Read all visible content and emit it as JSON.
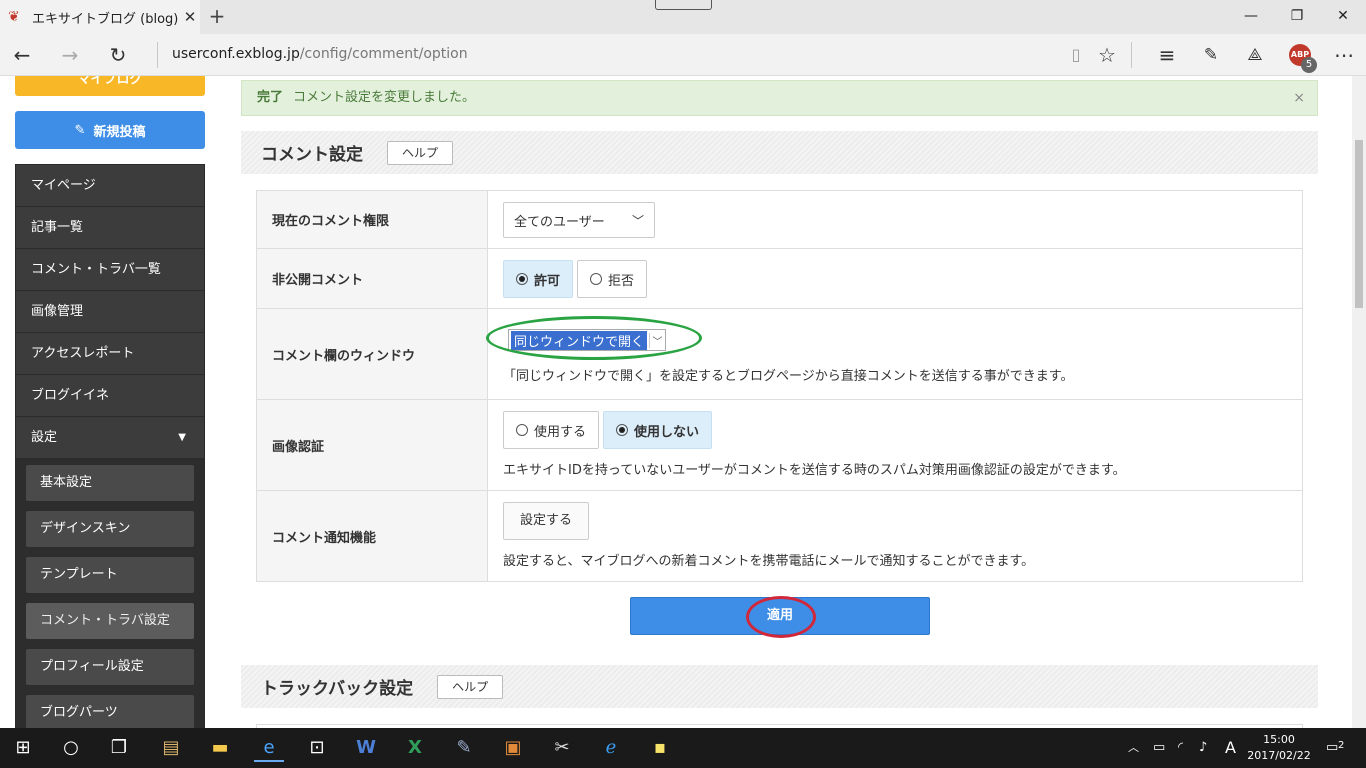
{
  "browser": {
    "tab_title": "エキサイトブログ (blog)|コメ",
    "tab_close": "✕",
    "new_tab": "+",
    "url_host": "userconf.exblog.jp",
    "url_path": "/config/comment/option",
    "abp_label": "ABP",
    "abp_count": "5"
  },
  "sidebar": {
    "myblog_label": "マイブログ",
    "new_post_label": "新規投稿",
    "items": [
      {
        "label": "マイページ"
      },
      {
        "label": "記事一覧"
      },
      {
        "label": "コメント・トラバ一覧"
      },
      {
        "label": "画像管理"
      },
      {
        "label": "アクセスレポート"
      },
      {
        "label": "ブログイイネ"
      },
      {
        "label": "設定"
      }
    ],
    "sub_items": [
      {
        "label": "基本設定"
      },
      {
        "label": "デザインスキン"
      },
      {
        "label": "テンプレート"
      },
      {
        "label": "コメント・トラバ設定"
      },
      {
        "label": "プロフィール設定"
      },
      {
        "label": "ブログパーツ"
      }
    ]
  },
  "alert": {
    "strong": "完了",
    "message": "コメント設定を変更しました。",
    "close": "×"
  },
  "comment_section": {
    "title": "コメント設定",
    "help": "ヘルプ",
    "rows": {
      "permission": {
        "label": "現在のコメント権限",
        "select_value": "全てのユーザー"
      },
      "private": {
        "label": "非公開コメント",
        "options": [
          "許可",
          "拒否"
        ],
        "selected": "許可"
      },
      "window": {
        "label": "コメント欄のウィンドウ",
        "select_value": "同じウィンドウで開く",
        "note": "「同じウィンドウで開く」を設定するとブログページから直接コメントを送信する事ができます。"
      },
      "captcha": {
        "label": "画像認証",
        "options": [
          "使用する",
          "使用しない"
        ],
        "selected": "使用しない",
        "note": "エキサイトIDを持っていないユーザーがコメントを送信する時のスパム対策用画像認証の設定ができます。"
      },
      "notify": {
        "label": "コメント通知機能",
        "button": "設定する",
        "note": "設定すると、マイブログへの新着コメントを携帯電話にメールで通知することができます。"
      }
    },
    "apply": "適用"
  },
  "trackback_section": {
    "title": "トラックバック設定",
    "help": "ヘルプ"
  },
  "taskbar": {
    "time": "15:00",
    "date": "2017/02/22",
    "ime": "A",
    "notifications": "2"
  }
}
